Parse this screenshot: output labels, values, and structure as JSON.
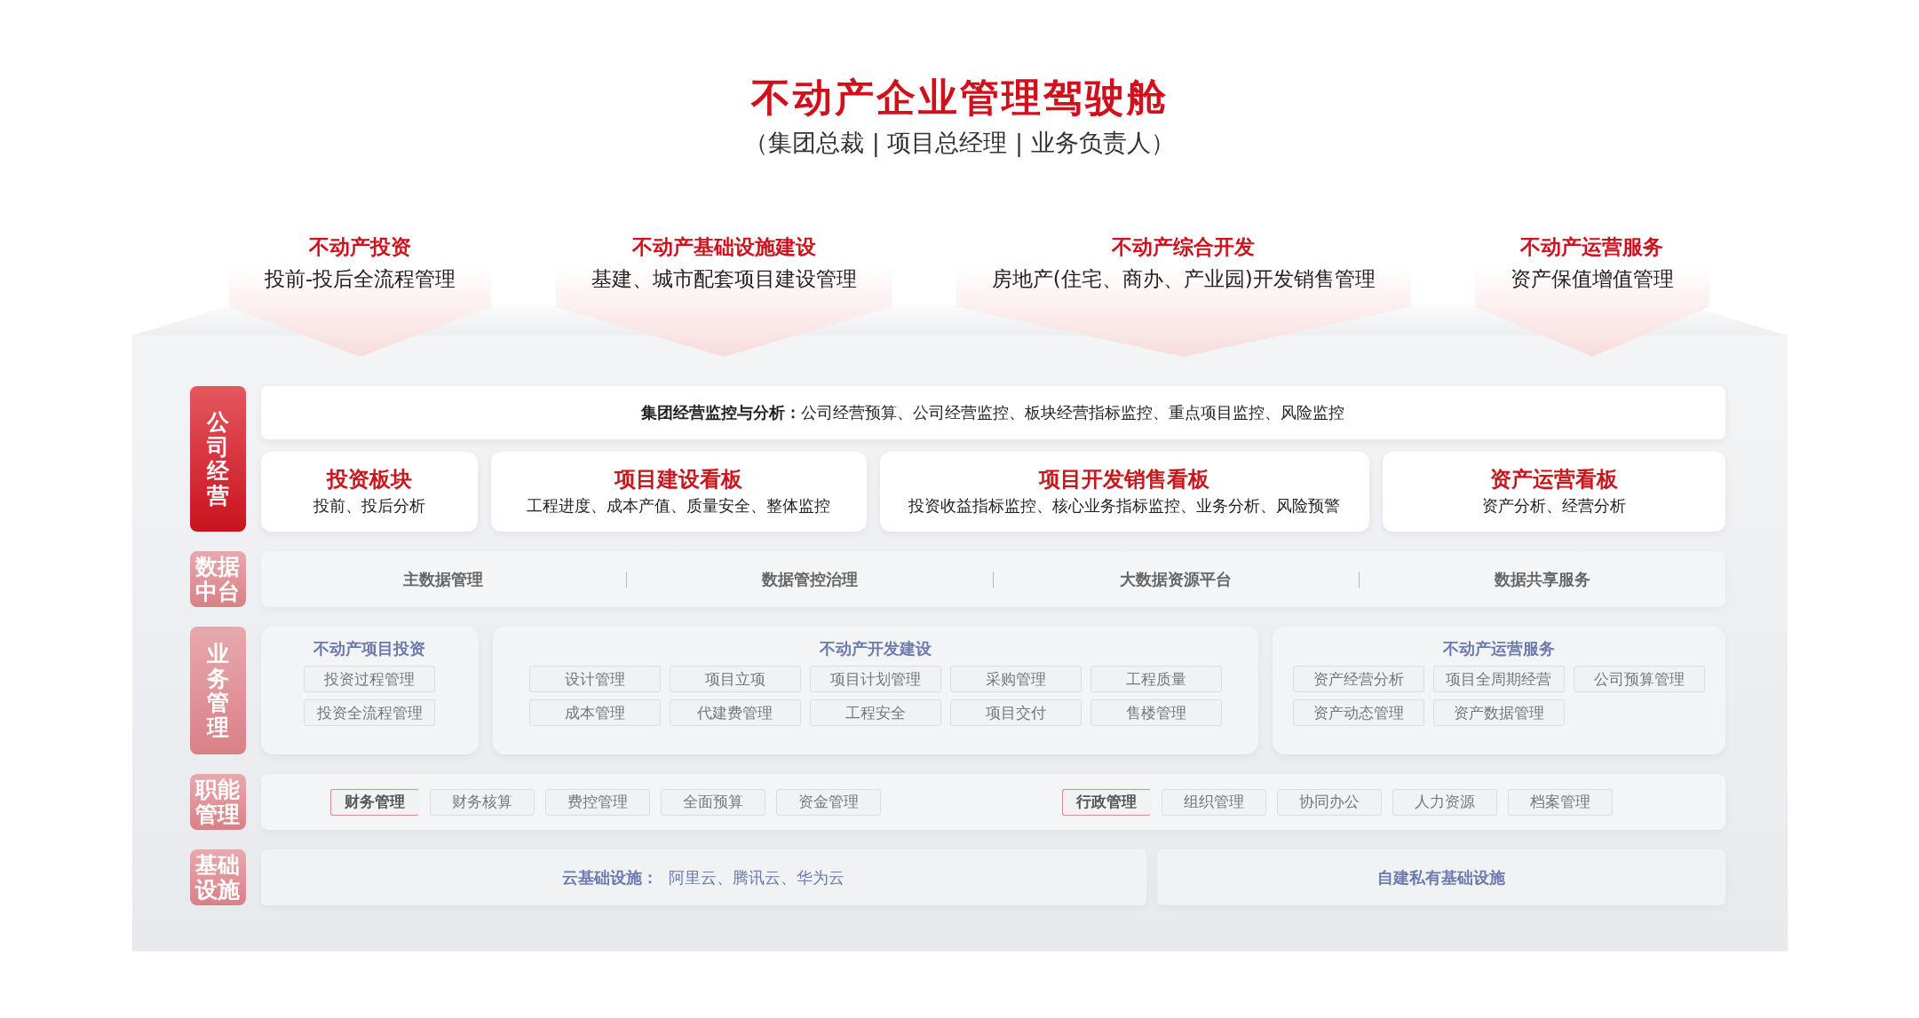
{
  "title": "不动产企业管理驾驶舱",
  "subtitle": "（集团总裁 | 项目总经理 | 业务负责人）",
  "categories": [
    {
      "title": "不动产投资",
      "description": "投前-投后全流程管理"
    },
    {
      "title": "不动产基础设施建设",
      "description": "基建、城市配套项目建设管理"
    },
    {
      "title": "不动产综合开发",
      "description": "房地产(住宅、商办、产业园)开发销售管理"
    },
    {
      "title": "不动产运营服务",
      "description": "资产保值增值管理"
    }
  ],
  "layers": [
    {
      "kind": "dashboards",
      "label": "公司经营",
      "highlighted": true,
      "banner": {
        "label": "集团经营监控与分析：",
        "items": "公司经营预算、公司经营监控、板块经营指标监控、重点项目监控、风险监控"
      },
      "boards": [
        {
          "title": "投资板块",
          "description": "投前、投后分析"
        },
        {
          "title": "项目建设看板",
          "description": "工程进度、成本产值、质量安全、整体监控"
        },
        {
          "title": "项目开发销售看板",
          "description": "投资收益指标监控、核心业务指标监控、业务分析、风险预警"
        },
        {
          "title": "资产运营看板",
          "description": "资产分析、经营分析"
        }
      ]
    },
    {
      "kind": "data",
      "label": "数据中台",
      "highlighted": false,
      "items": [
        "主数据管理",
        "数据管控治理",
        "大数据资源平台",
        "数据共享服务"
      ]
    },
    {
      "kind": "business",
      "label": "业务管理",
      "highlighted": false,
      "panels": [
        {
          "title": "不动产项目投资",
          "modules": [
            "投资过程管理",
            "投资全流程管理"
          ]
        },
        {
          "title": "不动产开发建设",
          "modules": [
            "设计管理",
            "项目立项",
            "项目计划管理",
            "采购管理",
            "工程质量",
            "成本管理",
            "代建费管理",
            "工程安全",
            "项目交付",
            "售楼管理"
          ]
        },
        {
          "title": "不动产运营服务",
          "modules": [
            "资产经营分析",
            "项目全周期经营",
            "公司预算管理",
            "资产动态管理",
            "资产数据管理"
          ]
        }
      ]
    },
    {
      "kind": "functions",
      "label": "职能管理",
      "highlighted": false,
      "groups": [
        {
          "head": "财务管理",
          "items": [
            "财务核算",
            "费控管理",
            "全面预算",
            "资金管理"
          ]
        },
        {
          "head": "行政管理",
          "items": [
            "组织管理",
            "协同办公",
            "人力资源",
            "档案管理"
          ]
        }
      ]
    },
    {
      "kind": "infrastructure",
      "label": "基础设施",
      "highlighted": false,
      "cloud": {
        "label": "云基础设施：",
        "providers": "阿里云、腾讯云、华为云"
      },
      "private": "自建私有基础设施"
    }
  ]
}
